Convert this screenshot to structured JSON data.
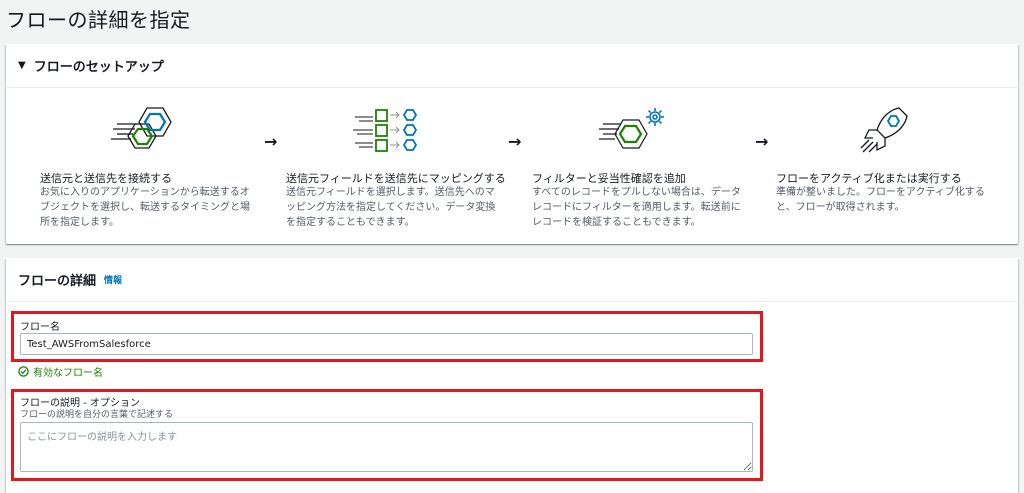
{
  "page": {
    "title": "フローの詳細を指定"
  },
  "setup": {
    "header": "フローのセットアップ",
    "steps": [
      {
        "icon": "connect-apps-icon",
        "title": "送信元と送信先を接続する",
        "desc": "お気に入りのアプリケーションから転送するオブジェクトを選択し、転送するタイミングと場所を指定します。"
      },
      {
        "icon": "field-mapping-icon",
        "title": "送信元フィールドを送信先にマッピングする",
        "desc": "送信元フィールドを選択します。送信先へのマッピング方法を指定してください。データ変換を指定することもできます。"
      },
      {
        "icon": "filter-settings-icon",
        "title": "フィルターと妥当性確認を追加",
        "desc": "すべてのレコードをプルしない場合は、データレコードにフィルターを適用します。転送前にレコードを検証することもできます。"
      },
      {
        "icon": "rocket-icon",
        "title": "フローをアクティブ化または実行する",
        "desc": "準備が整いました。フローをアクティブ化すると、フローが取得されます。"
      }
    ],
    "arrow": "→"
  },
  "details": {
    "header": "フローの詳細",
    "info_link": "情報",
    "name_label": "フロー名",
    "name_value": "Test_AWSFromSalesforce",
    "valid_text": "有効なフロー名",
    "desc_label": "フローの説明 - オプション",
    "desc_sub": "フローの説明を自分の言葉で記述する",
    "desc_placeholder": "ここにフローの説明を入力します"
  },
  "colors": {
    "accent": "#0073bb",
    "green": "#1d8102",
    "highlight": "#e4161f"
  }
}
